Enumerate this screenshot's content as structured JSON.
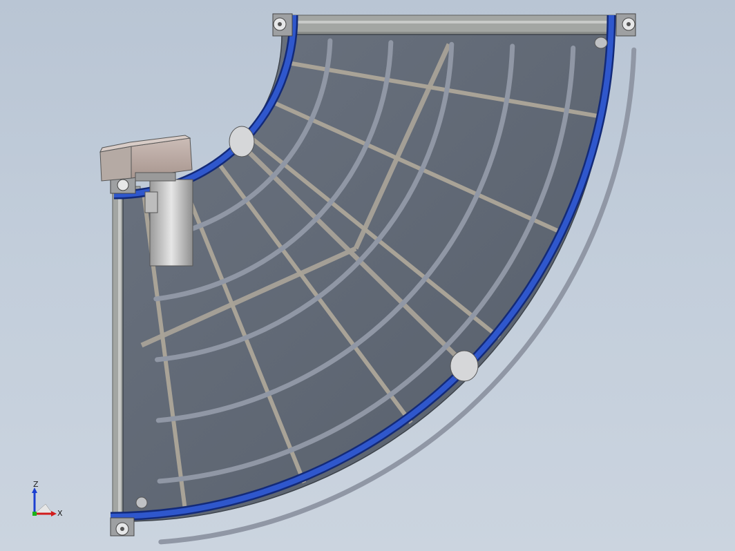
{
  "viewport": {
    "background_top": "#b9c5d4",
    "background_bottom": "#cbd4df"
  },
  "model": {
    "component": "curved-belt-conveyor-90deg",
    "colors": {
      "belt_guard": "#2a4fc0",
      "belt_guard_edge": "#132a78",
      "belt_surface": "#5d6672",
      "frame": "#a9aca9",
      "rib": "#8f95a3",
      "drive_motor": "#b8a8a2",
      "gearbox": "#c9c9c9"
    },
    "rib_count": 6,
    "crossbar_count": 6,
    "drive_unit_icon": "gear-motor-icon",
    "end_roller_icons": [
      "roller-cap-icon",
      "roller-cap-icon",
      "roller-cap-icon",
      "roller-cap-icon"
    ]
  },
  "triad": {
    "icon": "coordinate-triad-icon",
    "z_label": "Z",
    "x_label": "X",
    "colors": {
      "z": "#1b3fd1",
      "x": "#d11b1b",
      "y": "#1bb31b"
    }
  }
}
